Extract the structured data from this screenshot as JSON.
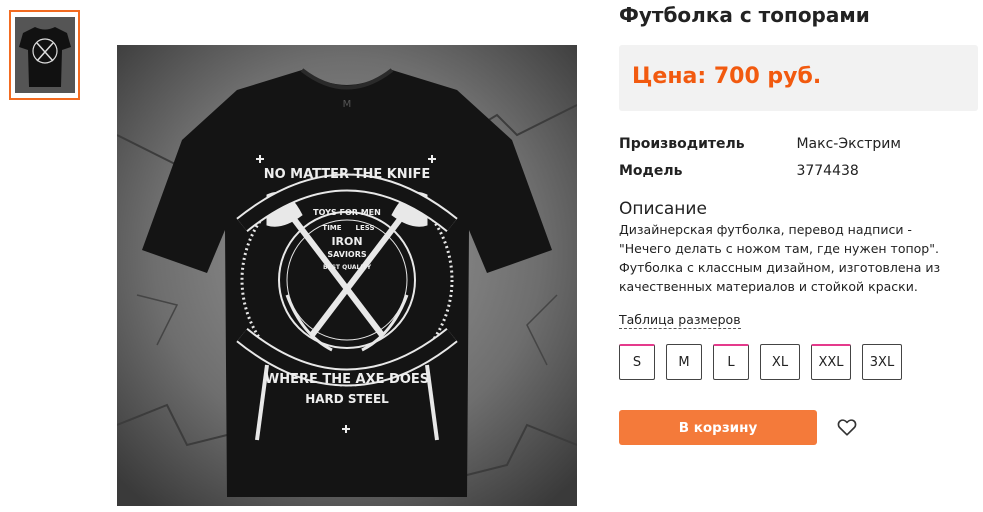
{
  "product": {
    "title": "Футболка с топорами",
    "price": "Цена: 700 руб.",
    "design_lines": [
      "NO MATTER THE KNIFE",
      "TOYS FOR MEN",
      "TIME",
      "LESS",
      "IRON",
      "SAVIORS",
      "BEST QUALITY",
      "WHERE THE AXE DOES",
      "HARD STEEL"
    ]
  },
  "specs": [
    {
      "label": "Производитель",
      "value": "Макс-Экстрим"
    },
    {
      "label": "Модель",
      "value": "3774438"
    }
  ],
  "description": {
    "heading": "Описание",
    "text": "Дизайнерская футболка, перевод надписи - \"Нечего делать с ножом там, где нужен топор\". Футболка с классным дизайном, изготовлена из качественных материалов и стойкой краски."
  },
  "size_table_link": "Таблица размеров",
  "sizes": [
    "S",
    "M",
    "L",
    "XL",
    "XXL",
    "3XL"
  ],
  "cart_button": "В корзину",
  "colors": {
    "accent": "#f25a0f",
    "button": "#f47a3a",
    "size_marker": "#e53a8c"
  },
  "icons": {
    "favorite": "heart-outline-icon"
  }
}
